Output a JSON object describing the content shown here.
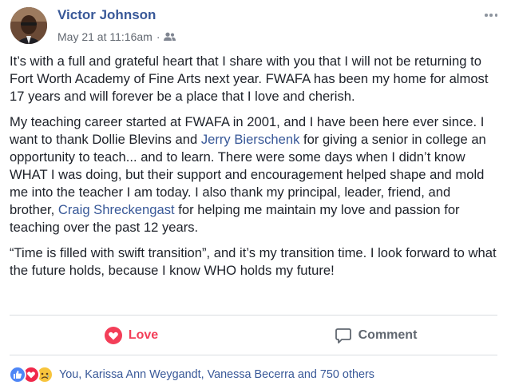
{
  "post": {
    "author": "Victor Johnson",
    "timestamp": "May 21 at 11:16am",
    "separator": "·",
    "audience_icon": "friends-icon",
    "paragraphs": {
      "p1": "It’s with a full and grateful heart that I share with you that I will not be returning to Fort Worth Academy of Fine Arts next year. FWAFA has been my home for almost 17 years and will forever be a place that I love and cherish.",
      "p2_a": "My teaching career started at FWAFA in 2001, and I have been here ever since. I want to thank Dollie Blevins and ",
      "p2_link1": "Jerry Bierschenk",
      "p2_b": " for giving a senior in college an opportunity to teach... and to learn. There were some days when I didn’t know WHAT I was doing, but their support and encouragement helped shape and mold me into the teacher I am today. I also thank my principal, leader, friend, and brother, ",
      "p2_link2": "Craig Shreckengast",
      "p2_c": " for helping me maintain my love and passion for teaching over the past 12 years.",
      "p3": "“Time is filled with swift transition”, and it’s my transition time. I look forward to what the future holds, because I know WHO holds my future!"
    }
  },
  "actions": {
    "love_label": "Love",
    "comment_label": "Comment"
  },
  "reactions": {
    "summary": "You, Karissa Ann Weygandt, Vanessa Becerra and 750 others",
    "icons": [
      "like-reaction-icon",
      "love-reaction-icon",
      "sad-reaction-icon"
    ]
  },
  "colors": {
    "link": "#385898",
    "love": "#f33e58",
    "text": "#1d2129",
    "muted": "#616770"
  }
}
